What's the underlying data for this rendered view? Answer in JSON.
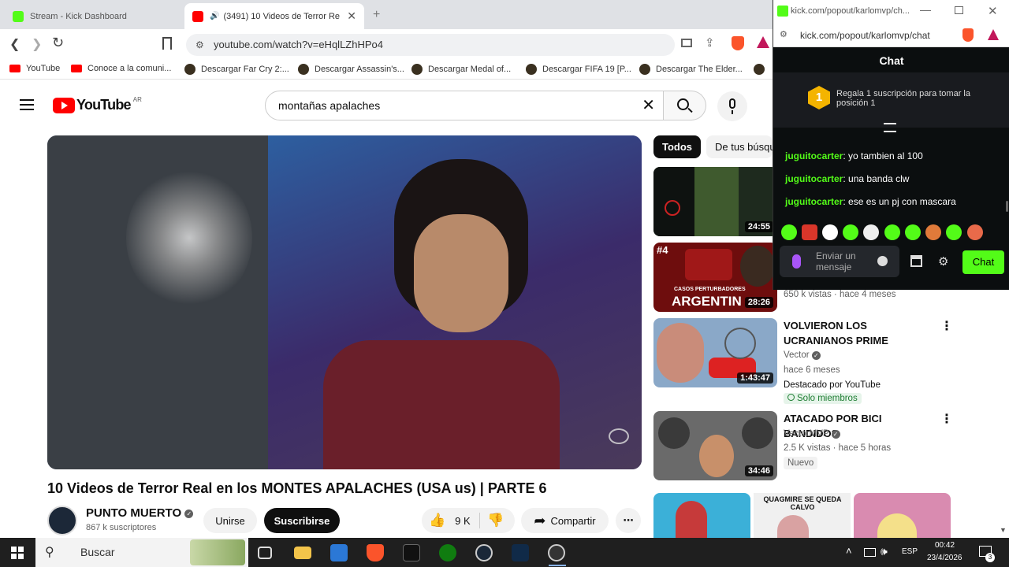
{
  "browser": {
    "tabs": [
      {
        "label": "Stream - Kick Dashboard",
        "favicon_color": "#53fc18"
      },
      {
        "label": "(3491) 10 Videos de Terror Re",
        "favicon_color": "#ff0000",
        "active": true
      }
    ],
    "url": "youtube.com/watch?v=eHqlLZhHPo4",
    "bookmarks": [
      "YouTube",
      "Conoce a la comuni...",
      "Descargar Far Cry 2:...",
      "Descargar Assassin's...",
      "Descargar Medal of...",
      "Descargar FIFA 19 [P...",
      "Descargar The Elder..."
    ]
  },
  "youtube": {
    "logo_text": "YouTube",
    "region": "AR",
    "search_query": "montañas apalaches",
    "video": {
      "title": "10 Videos de Terror Real en los MONTES APALACHES (USA us) | PARTE 6",
      "channel": "PUNTO MUERTO",
      "subscribers": "867 k suscriptores",
      "join_label": "Unirse",
      "subscribe_label": "Suscribirse",
      "likes": "9 K",
      "share_label": "Compartir"
    },
    "chips": [
      "Todos",
      "De tus búsqu"
    ],
    "related": [
      {
        "duration": "24:55",
        "thumb_color": "#3f5a2e"
      },
      {
        "duration": "28:26",
        "thumb_color": "#7a1010",
        "badge": "#4",
        "overlay_small": "CASOS PERTURBADORES",
        "overlay_big": "ARGENTIN",
        "meta": "650 k vistas · hace 4 meses"
      },
      {
        "duration": "1:43:47",
        "thumb_color": "#5a7a3a",
        "title": "VOLVIERON LOS UCRANIANOS PRIME",
        "channel": "Vector",
        "age": "hace 6 meses",
        "featured": "Destacado por YouTube",
        "members": "Solo miembros"
      },
      {
        "duration": "34:46",
        "thumb_color": "#5a5a5a",
        "title": "ATACADO POR BICI BANDIDOS",
        "channel": "VectorMVP",
        "meta": "2.5 K vistas · hace 5 horas",
        "badge": "Nuevo"
      }
    ],
    "bottom_thumb_text": "QUAGMIRE SE QUEDA CALVO"
  },
  "kick": {
    "window_title": "kick.com/popout/karlomvp/ch...",
    "url": "kick.com/popout/karlomvp/chat",
    "header": "Chat",
    "gift_text": "Regala 1 suscripción para tomar la posición 1",
    "gift_rank": "1",
    "messages": [
      {
        "user": "juguitocarter",
        "text": "yo tambien al 100"
      },
      {
        "user": "juguitocarter",
        "text": "una banda clw"
      },
      {
        "user": "juguitocarter",
        "text": "ese es un pj con mascara"
      }
    ],
    "input_placeholder": "Enviar un mensaje",
    "send_label": "Chat",
    "accent": "#53fc18"
  },
  "taskbar": {
    "search_placeholder": "Buscar",
    "language": "ESP",
    "time": "00:42",
    "date": "23/4/2026",
    "notifications": "3"
  }
}
